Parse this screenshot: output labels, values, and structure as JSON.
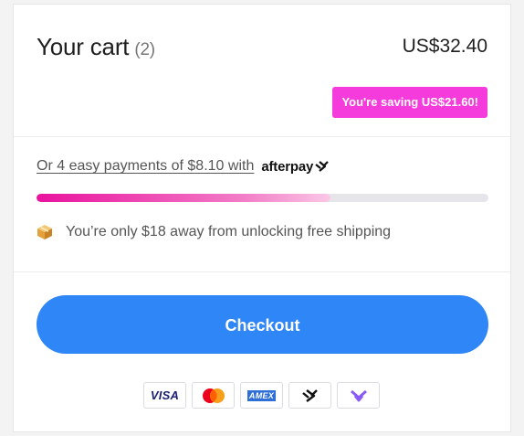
{
  "cart": {
    "title": "Your cart",
    "count": "(2)",
    "total": "US$32.40",
    "saving": "You're saving US$21.60!"
  },
  "afterpay": {
    "text": "Or 4 easy payments of $8.10 with",
    "brand": "afterpay"
  },
  "shipping": {
    "progress_fraction": 0.65,
    "message": "You’re only $18 away from unlocking free shipping",
    "icon": "package-icon"
  },
  "checkout": {
    "label": "Checkout"
  },
  "payment_methods": {
    "visa": "VISA",
    "mastercard_icon": "mastercard-icon",
    "amex": "AMEX",
    "afterpay_icon": "afterpay-icon",
    "extra_icon": "chevron-heart-icon"
  },
  "colors": {
    "accent_blue": "#2f86f6",
    "badge_pink": "#f53bdb",
    "progress_pink": "#e9129e"
  }
}
